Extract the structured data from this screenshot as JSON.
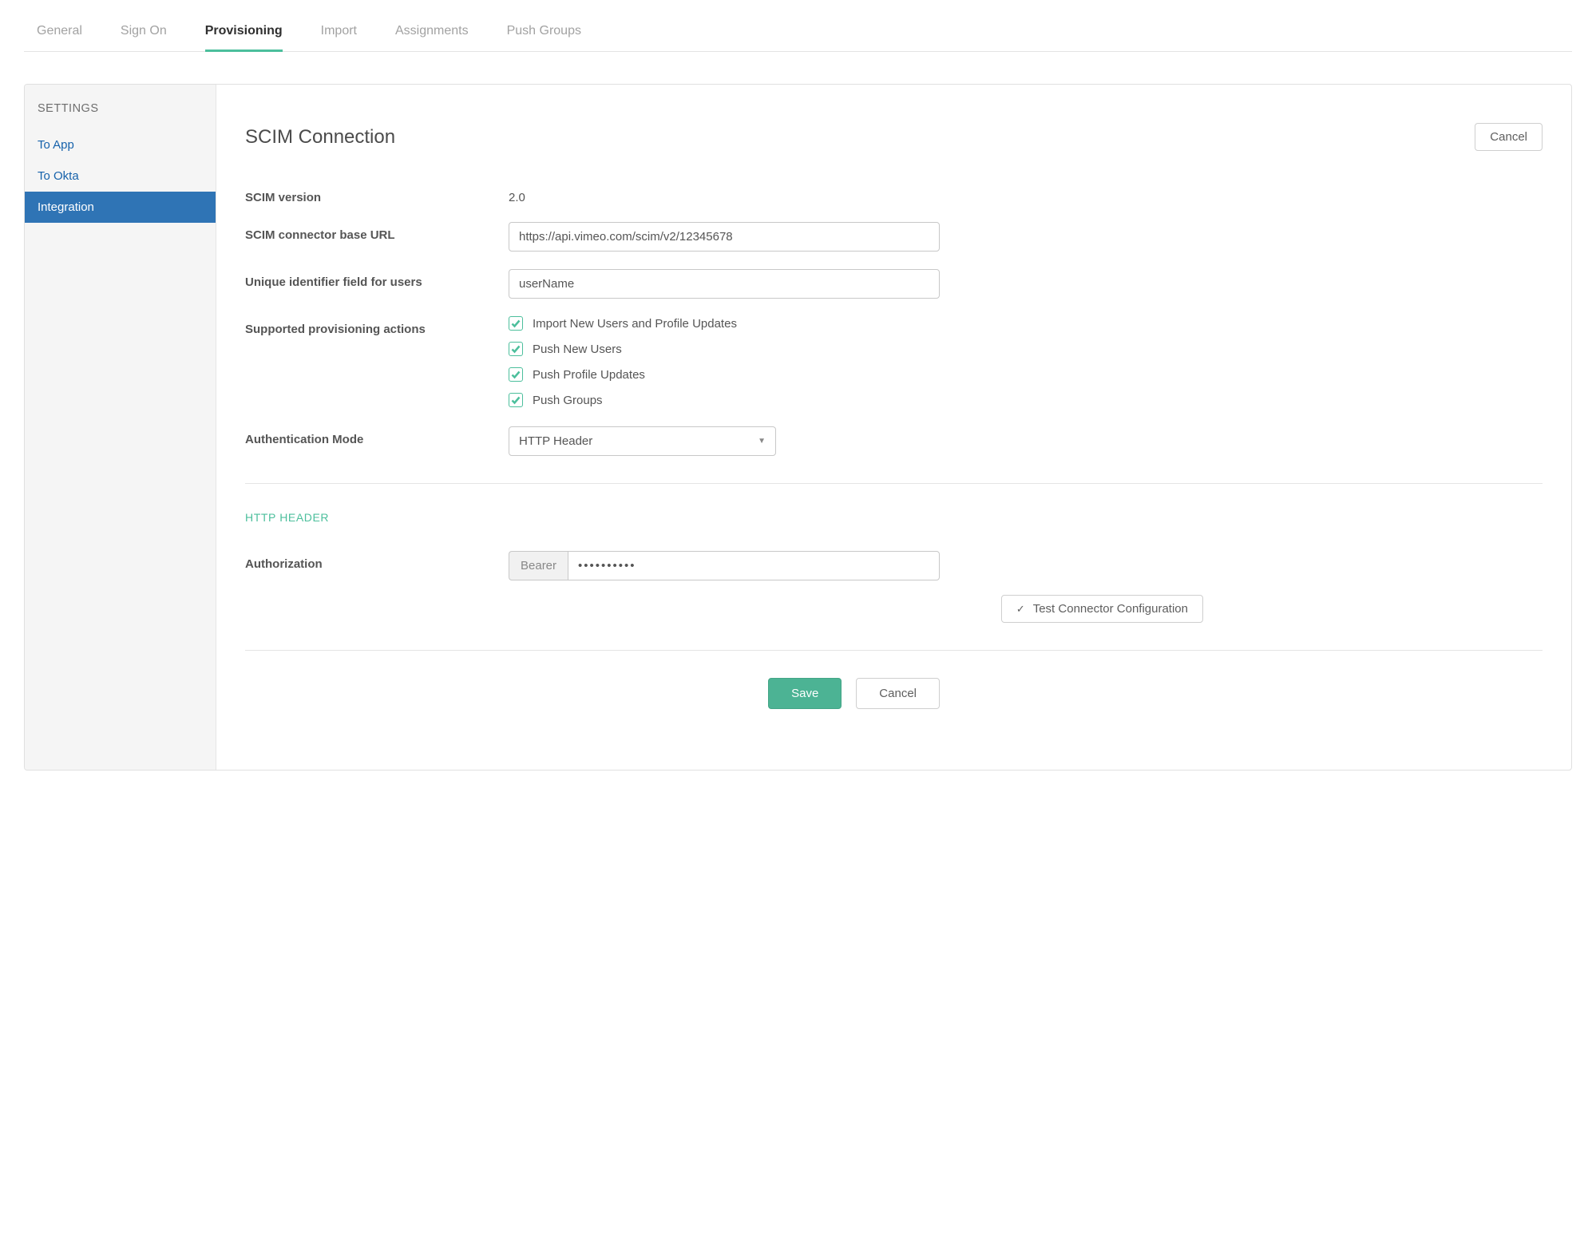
{
  "tabs": [
    {
      "label": "General"
    },
    {
      "label": "Sign On"
    },
    {
      "label": "Provisioning",
      "active": true
    },
    {
      "label": "Import"
    },
    {
      "label": "Assignments"
    },
    {
      "label": "Push Groups"
    }
  ],
  "sidebar": {
    "title": "SETTINGS",
    "items": [
      {
        "label": "To App"
      },
      {
        "label": "To Okta"
      },
      {
        "label": "Integration",
        "active": true
      }
    ]
  },
  "header": {
    "title": "SCIM Connection",
    "cancel_label": "Cancel"
  },
  "form": {
    "scim_version_label": "SCIM version",
    "scim_version_value": "2.0",
    "base_url_label": "SCIM connector base URL",
    "base_url_value": "https://api.vimeo.com/scim/v2/12345678",
    "uid_label": "Unique identifier field for users",
    "uid_value": "userName",
    "actions_label": "Supported provisioning actions",
    "actions": [
      {
        "label": "Import New Users and Profile Updates",
        "checked": true
      },
      {
        "label": "Push New Users",
        "checked": true
      },
      {
        "label": "Push Profile Updates",
        "checked": true
      },
      {
        "label": "Push Groups",
        "checked": true
      }
    ],
    "auth_mode_label": "Authentication Mode",
    "auth_mode_value": "HTTP Header"
  },
  "http_header": {
    "section_title": "HTTP HEADER",
    "authorization_label": "Authorization",
    "bearer_prefix": "Bearer",
    "token_masked": "••••••••••",
    "test_button_label": "Test Connector Configuration"
  },
  "footer": {
    "save_label": "Save",
    "cancel_label": "Cancel"
  }
}
